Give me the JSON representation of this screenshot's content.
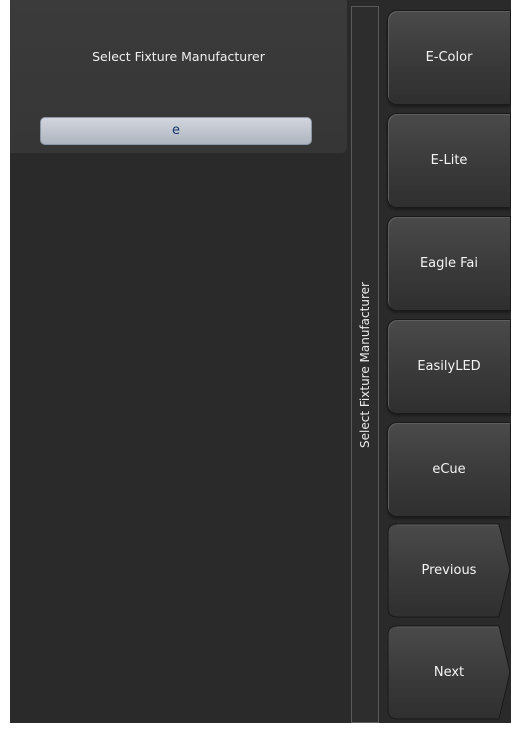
{
  "left_panel": {
    "title": "Select Fixture Manufacturer",
    "search_value": "e"
  },
  "side_label": "Select Fixture Manufacturer",
  "softkeys": [
    {
      "label": "E-Color"
    },
    {
      "label": "E-Lite"
    },
    {
      "label": "Eagle Fai"
    },
    {
      "label": "EasilyLED"
    },
    {
      "label": "eCue"
    },
    {
      "label": "Previous"
    },
    {
      "label": "Next"
    }
  ]
}
